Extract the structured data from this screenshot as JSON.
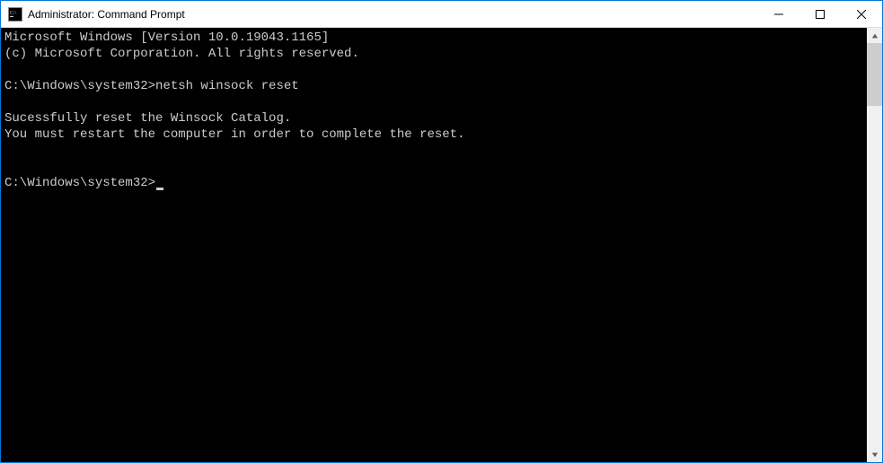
{
  "window": {
    "title": "Administrator: Command Prompt"
  },
  "terminal": {
    "lines": [
      "Microsoft Windows [Version 10.0.19043.1165]",
      "(c) Microsoft Corporation. All rights reserved.",
      "",
      "C:\\Windows\\system32>netsh winsock reset",
      "",
      "Sucessfully reset the Winsock Catalog.",
      "You must restart the computer in order to complete the reset.",
      "",
      ""
    ],
    "prompt": "C:\\Windows\\system32>"
  }
}
